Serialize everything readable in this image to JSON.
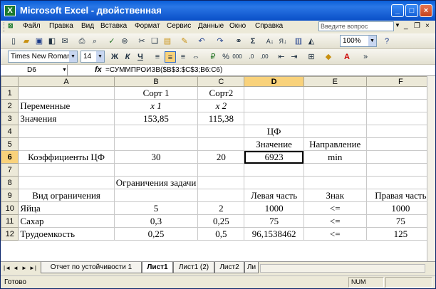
{
  "window": {
    "title": "Microsoft Excel - двойственная"
  },
  "menu": [
    "Файл",
    "Правка",
    "Вид",
    "Вставка",
    "Формат",
    "Сервис",
    "Данные",
    "Окно",
    "Справка"
  ],
  "help_placeholder": "Введите вопрос",
  "toolbar": {
    "zoom": "100%"
  },
  "format": {
    "font": "Times New Roman",
    "size": "14",
    "bold_label": "Ж",
    "italic_label": "К",
    "underline_label": "Ч"
  },
  "formula_bar": {
    "cell": "D6",
    "fx": "fx",
    "formula": "=СУММПРОИЗВ($B$3:$C$3;B6:C6)"
  },
  "columns": [
    "A",
    "B",
    "C",
    "D",
    "E",
    "F"
  ],
  "rows": [
    {
      "n": "1",
      "cells": [
        "",
        "Сорт 1",
        "Сорт2",
        "",
        "",
        ""
      ]
    },
    {
      "n": "2",
      "cells": [
        "Переменные",
        "x 1",
        "x 2",
        "",
        "",
        ""
      ]
    },
    {
      "n": "3",
      "cells": [
        "Значения",
        "153,85",
        "115,38",
        "",
        "",
        ""
      ]
    },
    {
      "n": "4",
      "cells": [
        "",
        "",
        "",
        "ЦФ",
        "",
        ""
      ]
    },
    {
      "n": "5",
      "cells": [
        "",
        "",
        "",
        "Значение",
        "Направление",
        ""
      ]
    },
    {
      "n": "6",
      "cells": [
        "Коэффициенты ЦФ",
        "30",
        "20",
        "6923",
        "min",
        ""
      ]
    },
    {
      "n": "7",
      "cells": [
        "",
        "",
        "",
        "",
        "",
        ""
      ]
    },
    {
      "n": "8",
      "cells": [
        "",
        "Ограничения задачи",
        "",
        "",
        "",
        ""
      ]
    },
    {
      "n": "9",
      "cells": [
        "Вид ограничения",
        "",
        "",
        "Левая часть",
        "Знак",
        "Правая часть"
      ]
    },
    {
      "n": "10",
      "cells": [
        "Яйца",
        "5",
        "2",
        "1000",
        "<=",
        "1000"
      ]
    },
    {
      "n": "11",
      "cells": [
        "Сахар",
        "0,3",
        "0,25",
        "75",
        "<=",
        "75"
      ]
    },
    {
      "n": "12",
      "cells": [
        "Трудоемкость",
        "0,25",
        "0,5",
        "96,1538462",
        "<=",
        "125"
      ]
    }
  ],
  "tabs": [
    "Отчет по устойчивости 1",
    "Лист1",
    "Лист1 (2)",
    "Лист2",
    "Ли"
  ],
  "status": {
    "text": "Готово",
    "num": "NUM"
  }
}
